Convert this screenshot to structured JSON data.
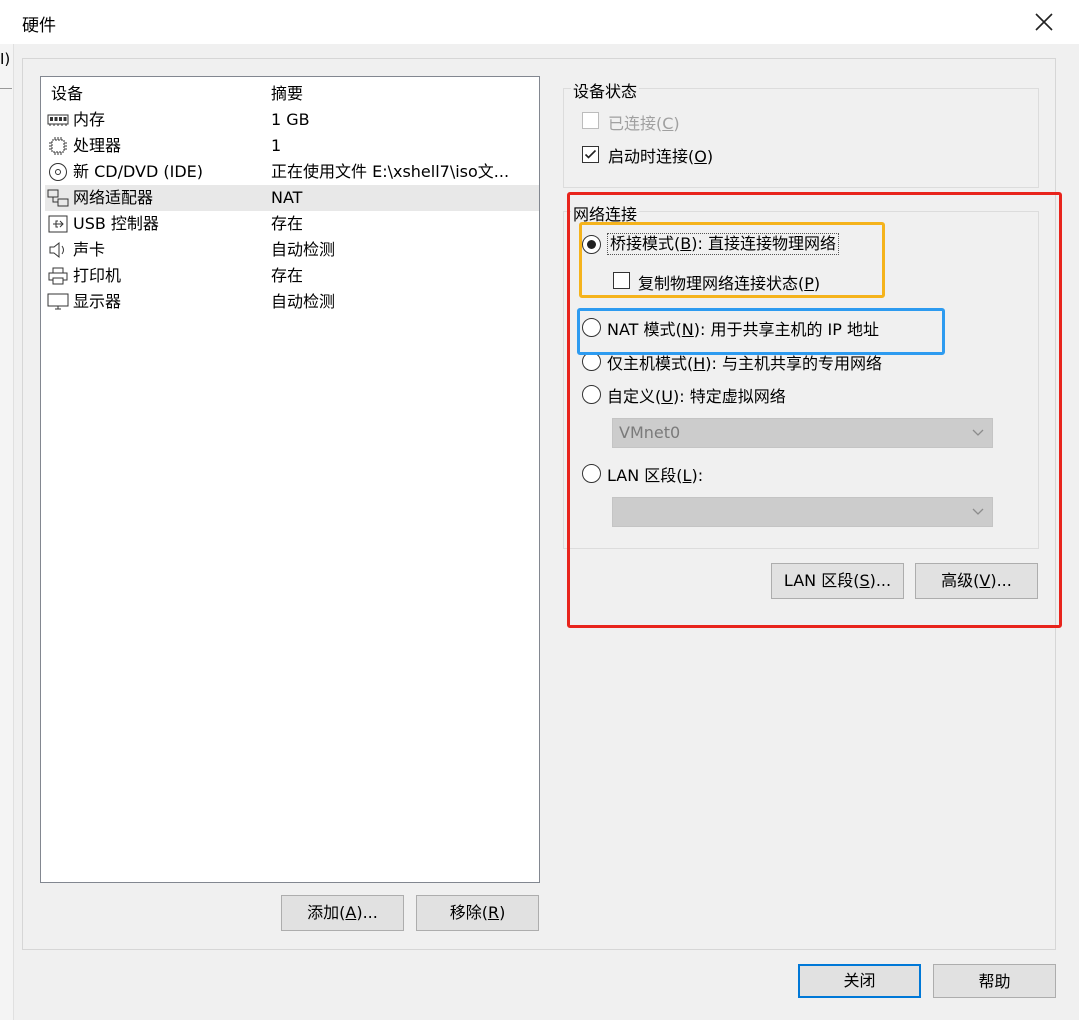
{
  "window": {
    "title": "硬件",
    "left_edge_char": "I)"
  },
  "device_list": {
    "header_device": "设备",
    "header_summary": "摘要",
    "items": [
      {
        "name": "内存",
        "summary": "1 GB",
        "icon": "memory-icon"
      },
      {
        "name": "处理器",
        "summary": "1",
        "icon": "cpu-icon"
      },
      {
        "name": "新 CD/DVD (IDE)",
        "summary": "正在使用文件 E:\\xshell7\\iso文...",
        "icon": "cd-icon"
      },
      {
        "name": "网络适配器",
        "summary": "NAT",
        "icon": "network-icon"
      },
      {
        "name": "USB 控制器",
        "summary": "存在",
        "icon": "usb-icon"
      },
      {
        "name": "声卡",
        "summary": "自动检测",
        "icon": "speaker-icon"
      },
      {
        "name": "打印机",
        "summary": "存在",
        "icon": "printer-icon"
      },
      {
        "name": "显示器",
        "summary": "自动检测",
        "icon": "monitor-icon"
      }
    ]
  },
  "buttons": {
    "add_pre": "添加(",
    "add_key": "A",
    "add_post": ")...",
    "remove_pre": "移除(",
    "remove_key": "R",
    "remove_post": ")",
    "close": "关闭",
    "help": "帮助",
    "lan_segments_pre": "LAN 区段(",
    "lan_segments_key": "S",
    "lan_segments_post": ")...",
    "advanced_pre": "高级(",
    "advanced_key": "V",
    "advanced_post": ")..."
  },
  "device_status": {
    "title": "设备状态",
    "connected_pre": "已连接(",
    "connected_key": "C",
    "connected_post": ")",
    "connect_at_power_on_pre": "启动时连接(",
    "connect_at_power_on_key": "O",
    "connect_at_power_on_post": ")"
  },
  "network_connection": {
    "title": "网络连接",
    "bridged_pre": "桥接模式(",
    "bridged_key": "B",
    "bridged_post": "): 直接连接物理网络",
    "replicate_pre": "复制物理网络连接状态(",
    "replicate_key": "P",
    "replicate_post": ")",
    "nat_pre": "NAT 模式(",
    "nat_key": "N",
    "nat_post": "): 用于共享主机的 IP 地址",
    "host_only_pre": "仅主机模式(",
    "host_only_key": "H",
    "host_only_post": "): 与主机共享的专用网络",
    "custom_pre": "自定义(",
    "custom_key": "U",
    "custom_post": "): 特定虚拟网络",
    "custom_value": "VMnet0",
    "lan_pre": "LAN 区段(",
    "lan_key": "L",
    "lan_post": "):",
    "lan_value": ""
  },
  "annotation_colors": {
    "red": "#e8241c",
    "orange": "#f5b31c",
    "blue": "#2d9bf0"
  }
}
